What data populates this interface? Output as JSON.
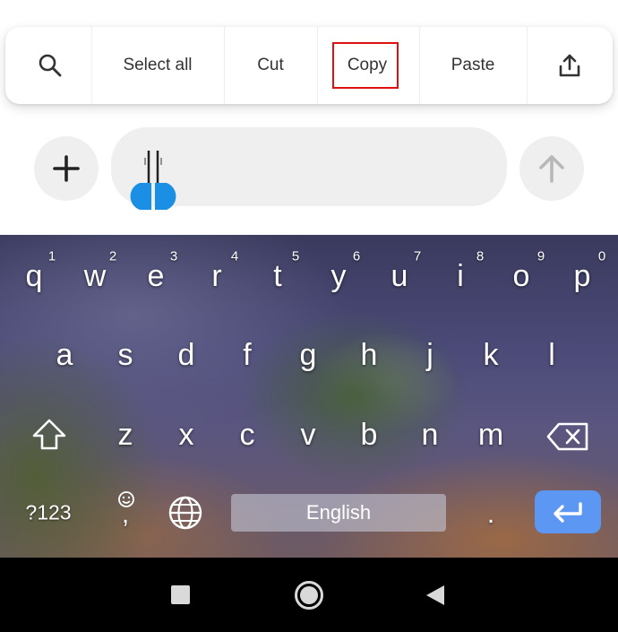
{
  "toolbar": {
    "items": [
      {
        "label": "Select all"
      },
      {
        "label": "Cut"
      },
      {
        "label": "Copy"
      },
      {
        "label": "Paste"
      }
    ],
    "icons": [
      "search-icon",
      "share-icon"
    ],
    "highlighted_item": "Copy",
    "highlight_color": "#e01010"
  },
  "keyboard": {
    "row1": [
      {
        "key": "q",
        "num": "1"
      },
      {
        "key": "w",
        "num": "2"
      },
      {
        "key": "e",
        "num": "3"
      },
      {
        "key": "r",
        "num": "4"
      },
      {
        "key": "t",
        "num": "5"
      },
      {
        "key": "y",
        "num": "6"
      },
      {
        "key": "u",
        "num": "7"
      },
      {
        "key": "i",
        "num": "8"
      },
      {
        "key": "o",
        "num": "9"
      },
      {
        "key": "p",
        "num": "0"
      }
    ],
    "row2": [
      "a",
      "s",
      "d",
      "f",
      "g",
      "h",
      "j",
      "k",
      "l"
    ],
    "row3": [
      "z",
      "x",
      "c",
      "v",
      "b",
      "n",
      "m"
    ],
    "symbols_label": "?123",
    "comma": ",",
    "space_label": "English",
    "period": ".",
    "enter_color": "#5b97f3"
  },
  "nav": {
    "icons": [
      "recents-square-icon",
      "home-circle-icon",
      "back-triangle-icon"
    ]
  }
}
